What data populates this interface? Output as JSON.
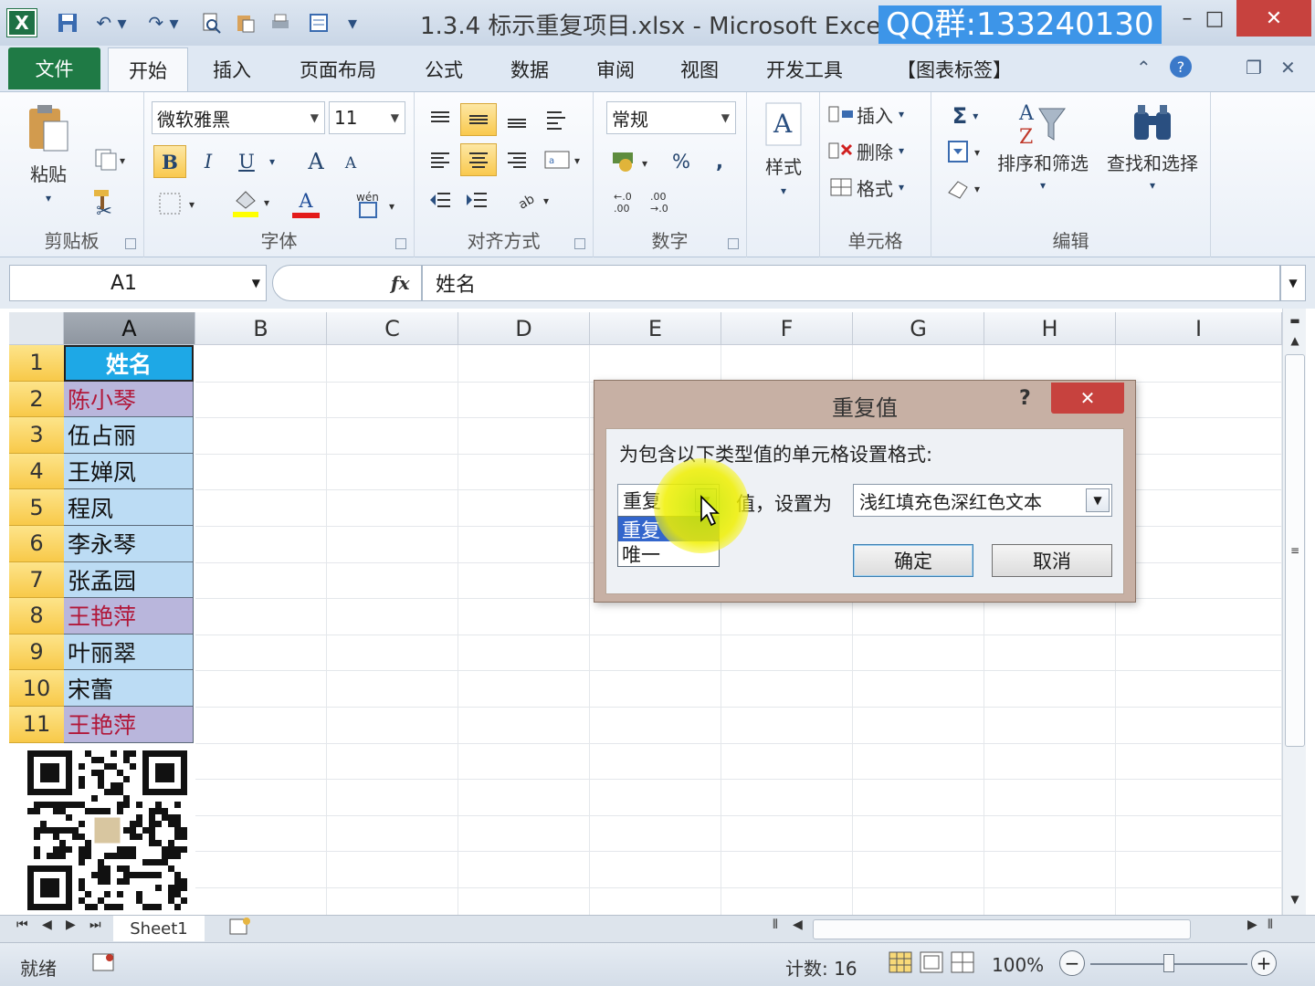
{
  "window": {
    "app_logo": "X",
    "title": "1.3.4 标示重复项目.xlsx - Microsoft Exce",
    "watermark": "QQ群:133240130",
    "controls": {
      "minimize": "–",
      "maximize": "□",
      "close": "✕"
    }
  },
  "tabs": {
    "file": "文件",
    "items": [
      "开始",
      "插入",
      "页面布局",
      "公式",
      "数据",
      "审阅",
      "视图",
      "开发工具",
      "【图表标签】"
    ],
    "active_index": 0
  },
  "ribbon": {
    "clipboard": {
      "paste": "粘贴",
      "label": "剪贴板"
    },
    "font": {
      "name": "微软雅黑",
      "size": "11",
      "bold": "B",
      "italic": "I",
      "underline": "U",
      "grow": "A",
      "shrink": "A",
      "font_color": "A",
      "label": "字体"
    },
    "alignment": {
      "label": "对齐方式"
    },
    "number": {
      "format": "常规",
      "percent": "%",
      "comma": ",",
      "label": "数字"
    },
    "styles": {
      "button": "样式"
    },
    "cells": {
      "insert": "插入",
      "delete": "删除",
      "format": "格式",
      "label": "单元格"
    },
    "editing": {
      "sum": "Σ",
      "sort": "排序和筛选",
      "find": "查找和选择",
      "label": "编辑"
    }
  },
  "formula_bar": {
    "name_box": "A1",
    "fx": "fx",
    "content": "姓名"
  },
  "columns": [
    "A",
    "B",
    "C",
    "D",
    "E",
    "F",
    "G",
    "H",
    "I"
  ],
  "rows": [
    {
      "n": "1",
      "v": "姓名",
      "t": "hdr"
    },
    {
      "n": "2",
      "v": "陈小琴",
      "t": "dup"
    },
    {
      "n": "3",
      "v": "伍占丽",
      "t": "normal"
    },
    {
      "n": "4",
      "v": "王婵凤",
      "t": "normal"
    },
    {
      "n": "5",
      "v": "程凤",
      "t": "normal"
    },
    {
      "n": "6",
      "v": "李永琴",
      "t": "normal"
    },
    {
      "n": "7",
      "v": "张孟园",
      "t": "normal"
    },
    {
      "n": "8",
      "v": "王艳萍",
      "t": "dup"
    },
    {
      "n": "9",
      "v": "叶丽翠",
      "t": "normal"
    },
    {
      "n": "10",
      "v": "宋蕾",
      "t": "normal"
    },
    {
      "n": "11",
      "v": "王艳萍",
      "t": "dup"
    }
  ],
  "dialog": {
    "title": "重复值",
    "help": "?",
    "close": "✕",
    "prompt": "为包含以下类型值的单元格设置格式:",
    "type_value": "重复",
    "options": [
      "重复",
      "唯一"
    ],
    "selected_option_index": 0,
    "middle_text": "值，设置为",
    "format_value": "浅红填充色深红色文本",
    "ok": "确定",
    "cancel": "取消"
  },
  "sheet": {
    "tab": "Sheet1"
  },
  "status": {
    "ready": "就绪",
    "count": "计数: 16",
    "zoom": "100%",
    "zoom_fraction": 0.5
  }
}
